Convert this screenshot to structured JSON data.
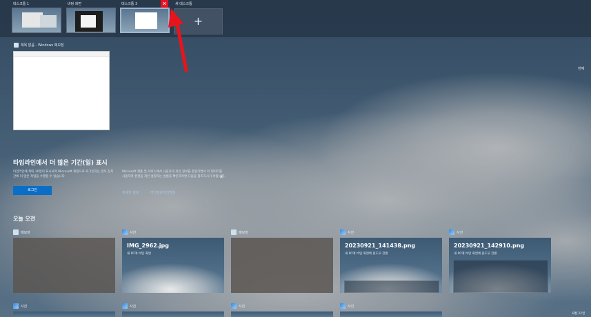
{
  "desktops": [
    {
      "label": "데스크톱 1"
    },
    {
      "label": "바탕 화면"
    },
    {
      "label": "데스크톱 3"
    },
    {
      "label": "새 데스크톱"
    }
  ],
  "new_desktop_icon": "+",
  "close_icon_glyph": "✕",
  "open_window": {
    "title": "제목 없음 - Windows 메모장",
    "icon": "notepad-icon"
  },
  "right_label": "현재",
  "timeline": {
    "heading": "타임라인에서 더 많은 기간(일) 표시",
    "desc_left": "타임라인에 최대 30일이 표시되며 Microsoft 계정으로 로그인하는 경우 장치 간에 더 많은 작업을 수행할 수 있습니다.",
    "login_label": "로그인",
    "desc_right": "Microsoft 제품 및 서비스에서 사용자의 개인 정보를 존중하면서 이 데이터를 사용하여 환경을 개인 설정하는 방법을 확인하려면 다음을 참조하시기 바랍니다.",
    "close_glyph": "✕",
    "link1": "자세한 정보",
    "link2": "개인정보처리방침"
  },
  "today_label": "오늘 오전",
  "cards_row1": [
    {
      "app": "메모장",
      "icon": "notepad-icon",
      "title": "",
      "sub": ""
    },
    {
      "app": "사진",
      "icon": "photos-icon",
      "title": "IMG_2962.jpg",
      "sub": "내 PC에 바탕 화면"
    },
    {
      "app": "메모장",
      "icon": "notepad-icon",
      "title": "",
      "sub": ""
    },
    {
      "app": "사진",
      "icon": "photos-icon",
      "title": "20230921_141438.png",
      "sub": "내 PC에 바탕 화면에 윈도우 전환"
    },
    {
      "app": "사진",
      "icon": "photos-icon",
      "title": "20230921_142910.png",
      "sub": "내 PC에 바탕 화면에 윈도우 전환"
    }
  ],
  "cards_row2": [
    {
      "app": "사진"
    },
    {
      "app": "사진"
    },
    {
      "app": "사진"
    },
    {
      "app": "사진"
    }
  ],
  "clock": "8월 22일",
  "colors": {
    "accent": "#0a6ec7",
    "close": "#e81123",
    "arrow": "#e8141c"
  }
}
